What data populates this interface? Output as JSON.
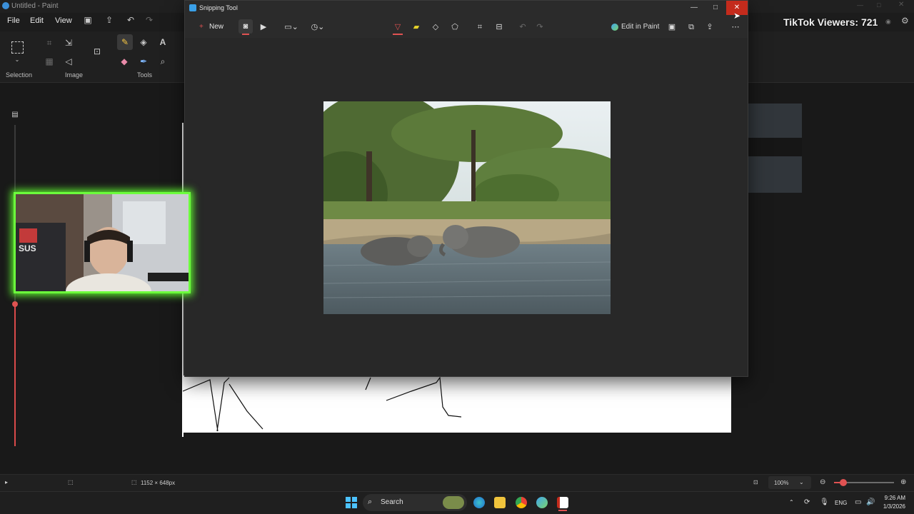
{
  "paint": {
    "title": "Untitled - Paint",
    "menu": [
      "File",
      "Edit",
      "View"
    ],
    "ribbon_groups": [
      "Selection",
      "Image",
      "Tools"
    ],
    "status": {
      "dimensions": "1152 × 648px",
      "zoom": "100%"
    }
  },
  "snipping_tool": {
    "title": "Snipping Tool",
    "new_label": "New",
    "edit_in_paint": "Edit in Paint"
  },
  "overlay": {
    "tiktok_viewers": "TikTok Viewers: 721"
  },
  "taskbar": {
    "search_label": "Search",
    "language": "ENG",
    "time": "9:26 AM",
    "date": "1/3/2026"
  },
  "colors": {
    "accent_close": "#c42b1c",
    "webcam_border": "#6cff3c",
    "slider_red": "#e05252"
  }
}
